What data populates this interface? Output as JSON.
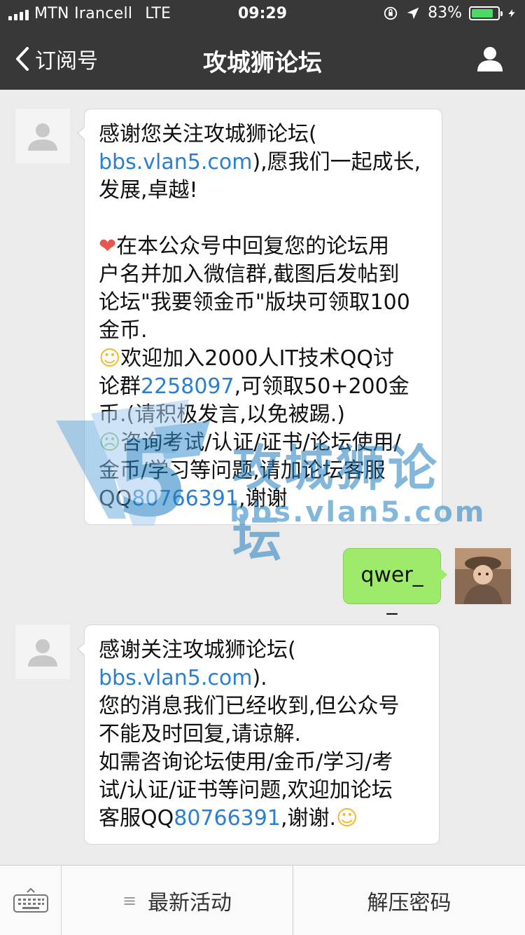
{
  "status_bar": {
    "carrier": "MTN Irancell",
    "network": "LTE",
    "time": "09:29",
    "battery_percent": "83%",
    "battery_level": 0.83
  },
  "nav": {
    "back_label": "订阅号",
    "title": "攻城狮论坛"
  },
  "messages": [
    {
      "direction": "in",
      "lines": [
        {
          "parts": [
            {
              "t": "感谢您关注攻城狮论坛("
            }
          ]
        },
        {
          "parts": [
            {
              "t": "bbs.vlan5.com",
              "link": true
            },
            {
              "t": "),愿我们一起成长,"
            }
          ]
        },
        {
          "parts": [
            {
              "t": "发展,卓越!"
            }
          ]
        },
        {
          "parts": [
            {
              "t": ""
            }
          ]
        },
        {
          "parts": [
            {
              "t": "❤",
              "emoji": "heart"
            },
            {
              "t": "在本公众号中回复您的论坛用"
            }
          ]
        },
        {
          "parts": [
            {
              "t": "户名并加入微信群,截图后发帖到"
            }
          ]
        },
        {
          "parts": [
            {
              "t": "论坛\"我要领金币\"版块可领取100"
            }
          ]
        },
        {
          "parts": [
            {
              "t": "金币."
            }
          ]
        },
        {
          "parts": [
            {
              "t": "☺",
              "emoji": "smile"
            },
            {
              "t": "欢迎加入2000人IT技术QQ讨"
            }
          ]
        },
        {
          "parts": [
            {
              "t": "论群"
            },
            {
              "t": "2258097",
              "link": true
            },
            {
              "t": ",可领取50+200金"
            }
          ]
        },
        {
          "parts": [
            {
              "t": "币.(请积极发言,以免被踢.)"
            }
          ]
        },
        {
          "parts": [
            {
              "t": "☹",
              "emoji": "tongue"
            },
            {
              "t": "咨询考试/认证/证书/论坛使用/"
            }
          ]
        },
        {
          "parts": [
            {
              "t": "金币/学习等问题,请加论坛客服"
            }
          ]
        },
        {
          "parts": [
            {
              "t": "QQ"
            },
            {
              "t": "80766391",
              "link": true
            },
            {
              "t": ",谢谢"
            }
          ]
        }
      ]
    },
    {
      "direction": "out",
      "text": "qwer__"
    },
    {
      "direction": "in",
      "lines": [
        {
          "parts": [
            {
              "t": "感谢关注攻城狮论坛("
            }
          ]
        },
        {
          "parts": [
            {
              "t": "bbs.vlan5.com",
              "link": true
            },
            {
              "t": ")."
            }
          ]
        },
        {
          "parts": [
            {
              "t": "您的消息我们已经收到,但公众号"
            }
          ]
        },
        {
          "parts": [
            {
              "t": "不能及时回复,请谅解."
            }
          ]
        },
        {
          "parts": [
            {
              "t": "如需咨询论坛使用/金币/学习/考"
            }
          ]
        },
        {
          "parts": [
            {
              "t": "试/认证/证书等问题,欢迎加论坛"
            }
          ]
        },
        {
          "parts": [
            {
              "t": "客服QQ"
            },
            {
              "t": "80766391",
              "link": true
            },
            {
              "t": ",谢谢."
            },
            {
              "t": "☺",
              "emoji": "smile"
            }
          ]
        }
      ]
    }
  ],
  "watermark": {
    "title": "攻城狮论坛",
    "subtitle": "bbs.vlan5.com"
  },
  "bottom_menu": {
    "menu_icon": "≡",
    "item1": "最新活动",
    "item2": "解压密码"
  },
  "colors": {
    "header_bg": "#383838",
    "chat_bg": "#ebebeb",
    "link": "#2a7fd0",
    "out_bubble": "#9eea6a"
  }
}
